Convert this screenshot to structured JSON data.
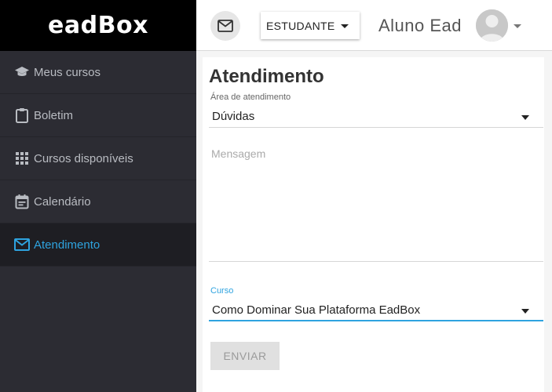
{
  "brand": {
    "logo_text": "eadBox"
  },
  "sidebar": {
    "items": [
      {
        "label": "Meus cursos",
        "icon": "graduation-cap-icon",
        "active": false
      },
      {
        "label": "Boletim",
        "icon": "clipboard-icon",
        "active": false
      },
      {
        "label": "Cursos disponíveis",
        "icon": "grid-icon",
        "active": false
      },
      {
        "label": "Calendário",
        "icon": "calendar-icon",
        "active": false
      },
      {
        "label": "Atendimento",
        "icon": "envelope-icon",
        "active": true
      }
    ]
  },
  "header": {
    "role_value": "ESTUDANTE",
    "user_name": "Aluno Ead",
    "mail_icon": "envelope-icon",
    "avatar_icon": "avatar-icon"
  },
  "form": {
    "title": "Atendimento",
    "area_label": "Área de atendimento",
    "area_value": "Dúvidas",
    "message_placeholder": "Mensagem",
    "message_value": "",
    "course_label": "Curso",
    "course_value": "Como Dominar Sua Plataforma EadBox",
    "submit_label": "ENVIAR"
  },
  "colors": {
    "accent": "#2ea3df",
    "sidebar_bg": "#2c2c33",
    "sidebar_active_bg": "#1e1e23",
    "logo_bar_bg": "#000000",
    "button_disabled_bg": "#e0e0e0"
  }
}
